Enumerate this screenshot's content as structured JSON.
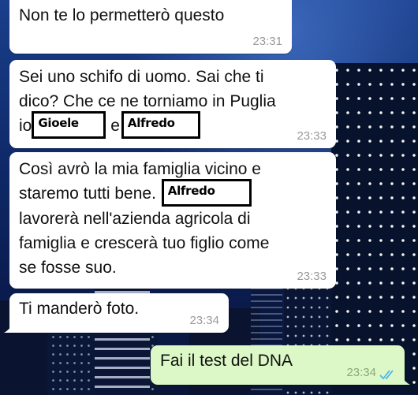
{
  "chat": {
    "messages": [
      {
        "direction": "incoming",
        "text": "Non te lo permetterò questo",
        "time": "23:31"
      },
      {
        "direction": "incoming",
        "line1": "Sei uno schifo di uomo.  Sai che ti",
        "line2": "dico?  Che ce ne torniamo in Puglia",
        "line3_a": "io",
        "name_a": "Gioele",
        "line3_b": "e",
        "name_b": "Alfredo",
        "time": "23:33"
      },
      {
        "direction": "incoming",
        "line1": "Così avrò la mia famiglia vicino e",
        "line2": "staremo tutti bene.",
        "name": "Alfredo",
        "line3": "lavorerà nell'azienda agricola di",
        "line4": "famiglia e crescerà tuo figlio come",
        "line5": "se fosse suo.",
        "time": "23:33"
      },
      {
        "direction": "incoming",
        "text": "Ti manderò foto.",
        "time": "23:34"
      },
      {
        "direction": "outgoing",
        "text": "Fai il test del DNA",
        "time": "23:34",
        "status": "read-double-check-icon"
      }
    ]
  },
  "colors": {
    "incoming_bubble": "#ffffff",
    "outgoing_bubble": "#dcf8c6",
    "read_ticks": "#4fb6ec"
  }
}
